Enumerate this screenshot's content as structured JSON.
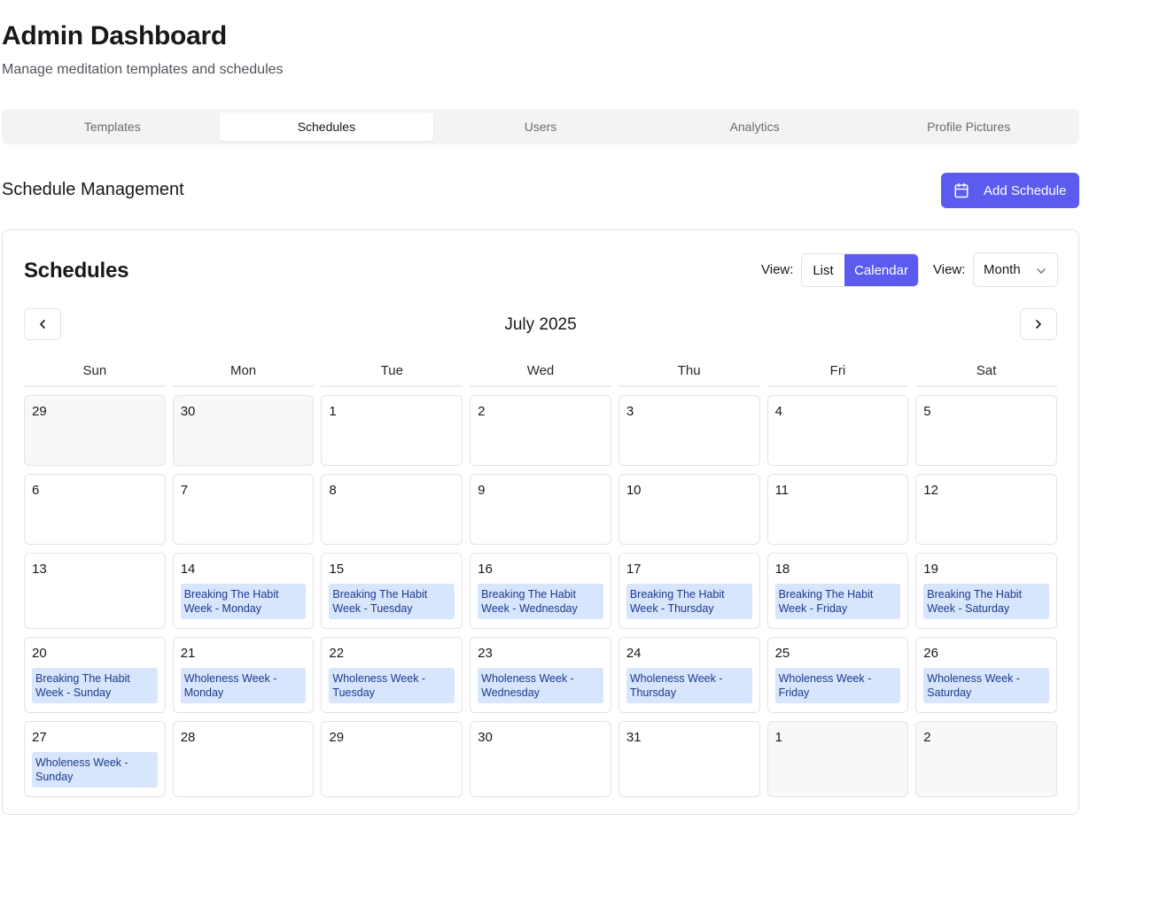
{
  "header": {
    "title": "Admin Dashboard",
    "subtitle": "Manage meditation templates and schedules"
  },
  "tabs": [
    {
      "label": "Templates",
      "active": false
    },
    {
      "label": "Schedules",
      "active": true
    },
    {
      "label": "Users",
      "active": false
    },
    {
      "label": "Analytics",
      "active": false
    },
    {
      "label": "Profile Pictures",
      "active": false
    }
  ],
  "section": {
    "title": "Schedule Management",
    "add_button_label": "Add Schedule",
    "add_button_icon": "calendar-icon"
  },
  "colors": {
    "accent": "#5b5bf0",
    "event_bg": "#d7e5fd",
    "event_text": "#1e3a8a"
  },
  "card": {
    "title": "Schedules",
    "view_label_1": "View:",
    "view_label_2": "View:",
    "toggle": {
      "list": "List",
      "calendar": "Calendar",
      "selected": "Calendar"
    },
    "select_value": "Month"
  },
  "calendar": {
    "month_label": "July 2025",
    "weekdays": [
      "Sun",
      "Mon",
      "Tue",
      "Wed",
      "Thu",
      "Fri",
      "Sat"
    ],
    "weeks": [
      [
        {
          "day": "29",
          "outside": true
        },
        {
          "day": "30",
          "outside": true
        },
        {
          "day": "1"
        },
        {
          "day": "2"
        },
        {
          "day": "3"
        },
        {
          "day": "4"
        },
        {
          "day": "5"
        }
      ],
      [
        {
          "day": "6"
        },
        {
          "day": "7"
        },
        {
          "day": "8"
        },
        {
          "day": "9"
        },
        {
          "day": "10"
        },
        {
          "day": "11"
        },
        {
          "day": "12"
        }
      ],
      [
        {
          "day": "13"
        },
        {
          "day": "14",
          "event": "Breaking The Habit Week - Monday"
        },
        {
          "day": "15",
          "event": "Breaking The Habit Week - Tuesday"
        },
        {
          "day": "16",
          "event": "Breaking The Habit Week - Wednesday"
        },
        {
          "day": "17",
          "event": "Breaking The Habit Week - Thursday"
        },
        {
          "day": "18",
          "event": "Breaking The Habit Week - Friday"
        },
        {
          "day": "19",
          "event": "Breaking The Habit Week - Saturday"
        }
      ],
      [
        {
          "day": "20",
          "event": "Breaking The Habit Week - Sunday"
        },
        {
          "day": "21",
          "event": "Wholeness Week - Monday"
        },
        {
          "day": "22",
          "event": "Wholeness Week - Tuesday"
        },
        {
          "day": "23",
          "event": "Wholeness Week - Wednesday"
        },
        {
          "day": "24",
          "event": "Wholeness Week - Thursday"
        },
        {
          "day": "25",
          "event": "Wholeness Week - Friday"
        },
        {
          "day": "26",
          "event": "Wholeness Week - Saturday"
        }
      ],
      [
        {
          "day": "27",
          "event": "Wholeness Week - Sunday"
        },
        {
          "day": "28"
        },
        {
          "day": "29"
        },
        {
          "day": "30"
        },
        {
          "day": "31"
        },
        {
          "day": "1",
          "outside": true
        },
        {
          "day": "2",
          "outside": true
        }
      ]
    ]
  }
}
